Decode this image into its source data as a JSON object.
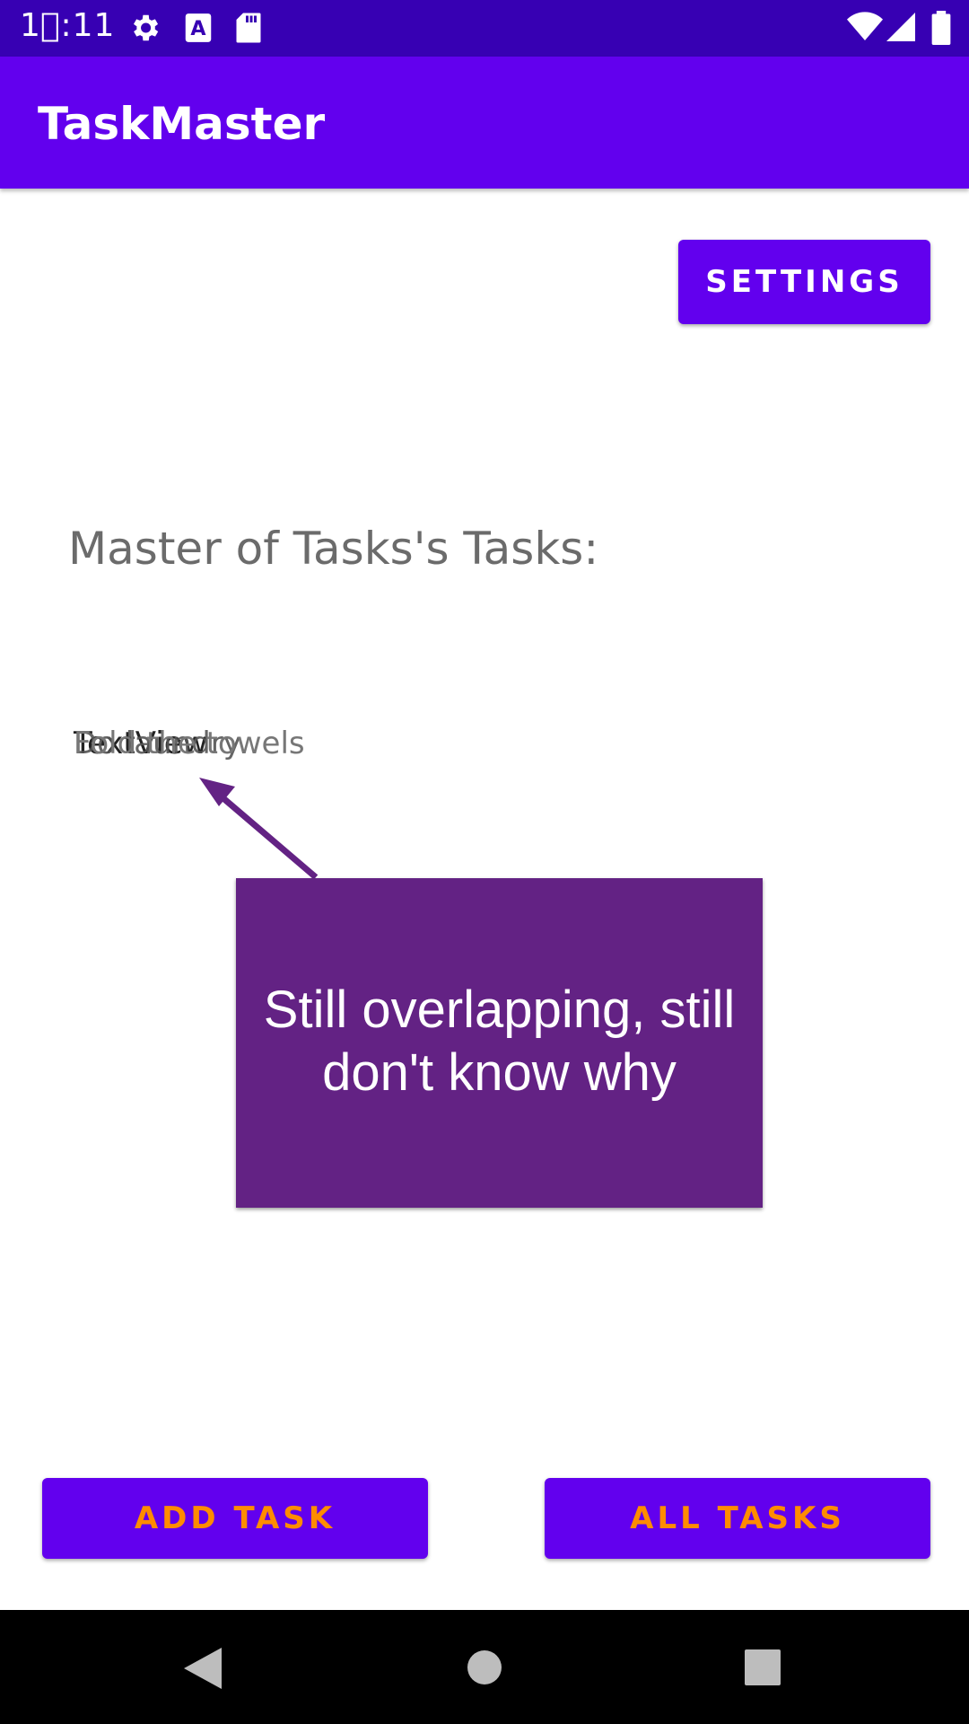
{
  "status_bar": {
    "time": "1⃞:11",
    "icons": [
      "settings-gear-icon",
      "text-a-icon",
      "sd-card-icon",
      "wifi-icon",
      "signal-icon",
      "battery-icon"
    ]
  },
  "app_bar": {
    "title": "TaskMaster"
  },
  "main": {
    "settings_label": "SETTINGS",
    "tasks_header": "Master of Tasks's Tasks:",
    "overlapping_texts": [
      "TextView",
      "Do laundry",
      "Fold the towels"
    ],
    "callout_text": "Still overlapping, still don't know why",
    "add_task_label": "ADD TASK",
    "all_tasks_label": "ALL TASKS"
  },
  "nav_bar": {
    "icons": [
      "back-icon",
      "home-icon",
      "recents-icon"
    ]
  },
  "colors": {
    "status_bar": "#3700b3",
    "app_bar": "#6200ee",
    "button": "#6200ee",
    "button_text_accent": "#ff8c00",
    "callout": "#632284"
  }
}
